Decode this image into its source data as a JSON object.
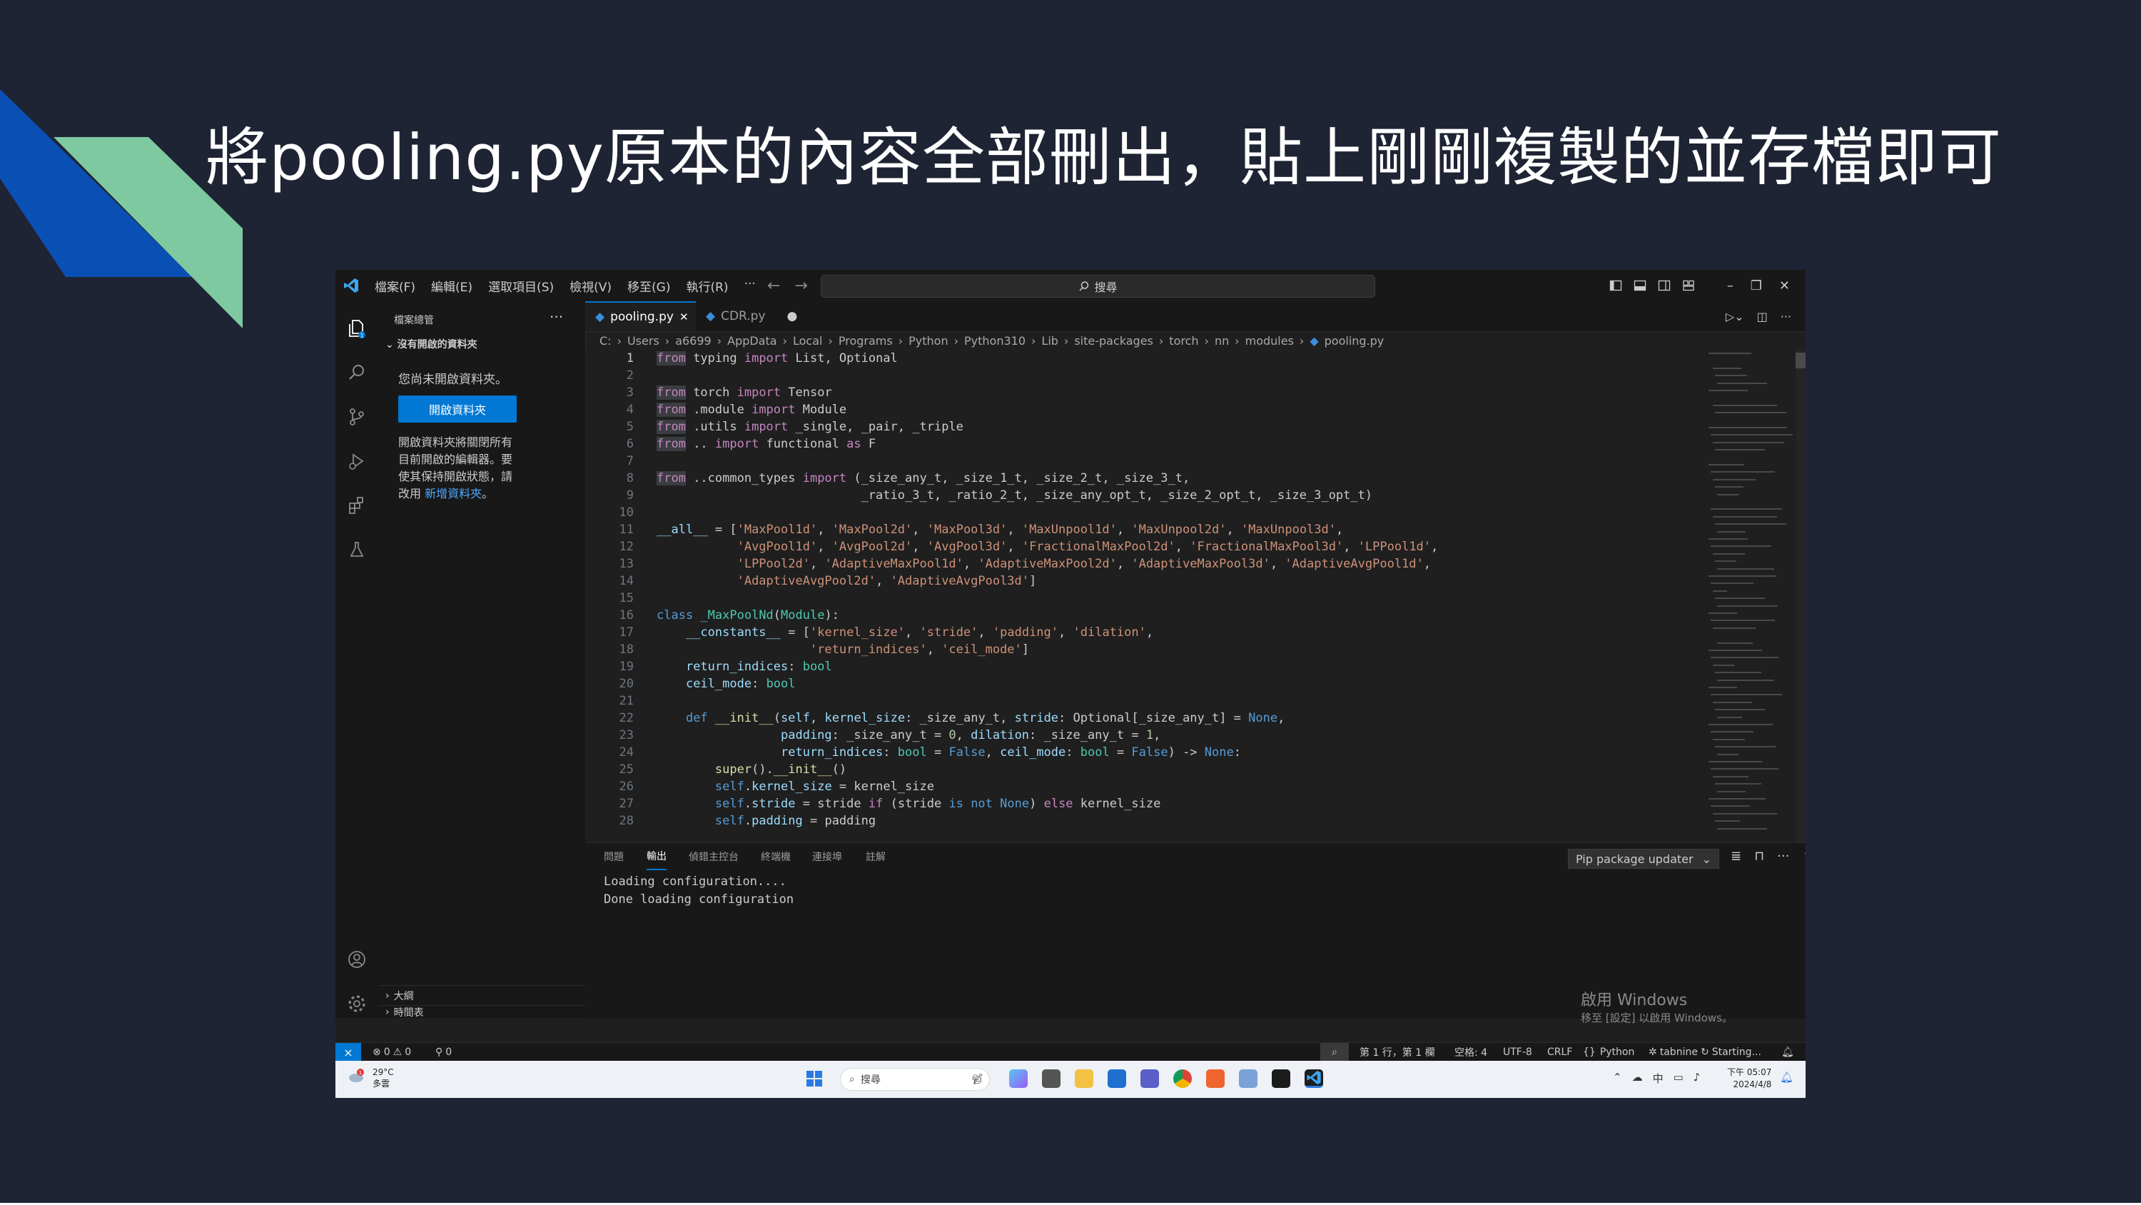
{
  "slide": {
    "title": "將pooling.py原本的內容全部刪出，貼上剛剛複製的並存檔即可"
  },
  "titlebar": {
    "menu": [
      "檔案(F)",
      "編輯(E)",
      "選取項目(S)",
      "檢視(V)",
      "移至(G)",
      "執行(R)",
      "···"
    ],
    "search_label": "搜尋"
  },
  "sidebar": {
    "header": "檔案總管",
    "dots": "···",
    "folder_title": "沒有開啟的資料夾",
    "no_folder": "您尚未開啟資料夾。",
    "open_button": "開啟資料夾",
    "description": "開啟資料夾將關閉所有目前開啟的編輯器。要使其保持開啟狀態，請改用",
    "description_link": "新增資料夾",
    "description_end": "。",
    "outline": "大綱",
    "timeline": "時間表"
  },
  "tabs": [
    {
      "label": "pooling.py",
      "active": true
    },
    {
      "label": "CDR.py",
      "active": false
    }
  ],
  "breadcrumb": [
    "C:",
    "Users",
    "a6699",
    "AppData",
    "Local",
    "Programs",
    "Python",
    "Python310",
    "Lib",
    "site-packages",
    "torch",
    "nn",
    "modules",
    "pooling.py"
  ],
  "editor": {
    "line_numbers": [
      "1",
      "2",
      "3",
      "4",
      "5",
      "6",
      "7",
      "8",
      "9",
      "10",
      "11",
      "12",
      "13",
      "14",
      "15",
      "16",
      "17",
      "18",
      "19",
      "20",
      "21",
      "22",
      "23",
      "24",
      "25",
      "26",
      "27",
      "28"
    ]
  },
  "panel": {
    "tabs": [
      "問題",
      "輸出",
      "偵錯主控台",
      "終端機",
      "連接埠",
      "註解"
    ],
    "active_tab": "輸出",
    "dropdown": "Pip package updater",
    "output": [
      "Loading configuration....",
      "Done loading configuration"
    ],
    "activate_line1": "啟用 Windows",
    "activate_line2": "移至 [設定] 以啟用 Windows。"
  },
  "statusbar": {
    "errors": "0",
    "warnings": "0",
    "ports": "0",
    "position": "第 1 行，第 1 欄",
    "spaces": "空格: 4",
    "encoding": "UTF-8",
    "eol": "CRLF",
    "language": "Python",
    "tabnine": "tabnine",
    "starting": "Starting..."
  },
  "taskbar": {
    "weather_temp": "29°C",
    "weather_desc": "多雲",
    "search_label": "搜尋",
    "lang": "中",
    "time": "下午 05:07",
    "date": "2024/4/8"
  },
  "colors": {
    "slide_bg": "#1e2433",
    "accent_blue": "#0a4fb3",
    "accent_green": "#7ec9a0",
    "vscode_blue": "#0078d4"
  }
}
